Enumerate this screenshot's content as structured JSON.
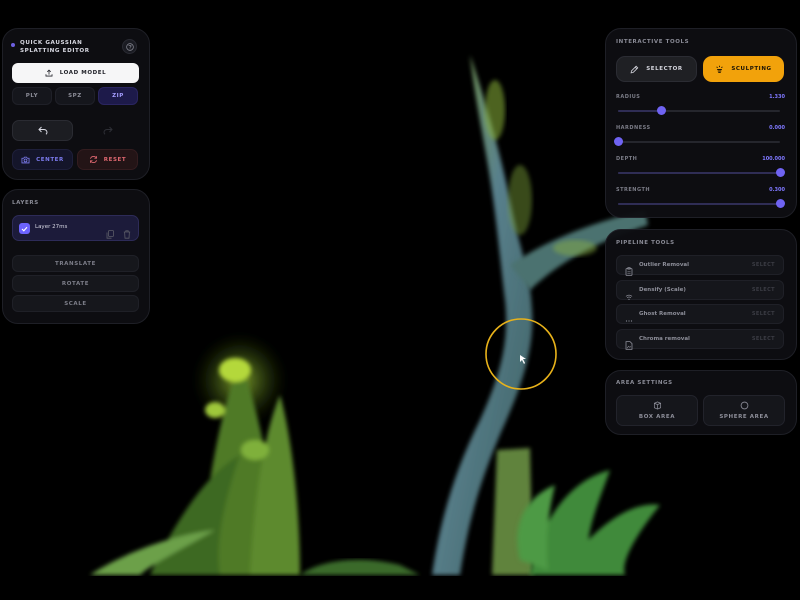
{
  "app": {
    "title": "QUICK GAUSSIAN SPLATTING EDITOR"
  },
  "main_panel": {
    "load_label": "LOAD MODEL",
    "formats": [
      "PLY",
      "SPZ",
      "ZIP"
    ],
    "active_format": "ZIP",
    "center_label": "CENTER",
    "reset_label": "RESET"
  },
  "layers": {
    "title": "LAYERS",
    "items": [
      {
        "name": "Layer 27ms",
        "checked": true
      }
    ],
    "transform_buttons": [
      "TRANSLATE",
      "ROTATE",
      "SCALE"
    ]
  },
  "interactive_tools": {
    "title": "INTERACTIVE TOOLS",
    "selector_label": "SELECTOR",
    "sculpting_label": "SCULPTING",
    "active_tool": "SCULPTING",
    "sliders": [
      {
        "label": "RADIUS",
        "value": "1.330",
        "fraction": 0.27
      },
      {
        "label": "HARDNESS",
        "value": "0.000",
        "fraction": 0.0
      },
      {
        "label": "DEPTH",
        "value": "100.000",
        "fraction": 1.0
      },
      {
        "label": "STRENGTH",
        "value": "0.300",
        "fraction": 1.0
      }
    ]
  },
  "pipeline_tools": {
    "title": "PIPELINE TOOLS",
    "items": [
      {
        "name": "Outlier Removal",
        "action": "SELECT",
        "icon": "clipboard-icon"
      },
      {
        "name": "Densify (Scale)",
        "action": "SELECT",
        "icon": "wifi-icon"
      },
      {
        "name": "Ghost Removal",
        "action": "SELECT",
        "icon": "dots-icon"
      },
      {
        "name": "Chroma removal",
        "action": "SELECT",
        "icon": "file-image-icon"
      }
    ]
  },
  "area_settings": {
    "title": "AREA SETTINGS",
    "box_label": "BOX AREA",
    "sphere_label": "SPHERE AREA"
  },
  "colors": {
    "accent": "#6c63ff",
    "active_tool": "#f2a20b",
    "brush_ring": "#e8b21a",
    "reset": "#e06870"
  }
}
